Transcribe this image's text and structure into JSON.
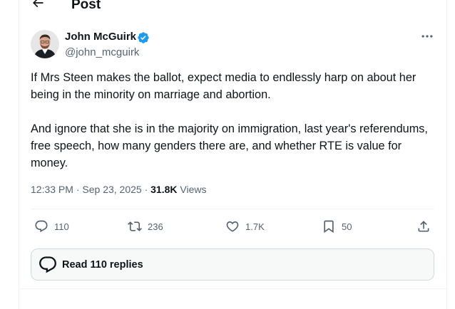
{
  "header": {
    "title": "Post",
    "back_icon": "arrow-left-icon"
  },
  "author": {
    "name": "John McGuirk",
    "handle": "@john_mcguirk",
    "verified_color": "#1d9bf0"
  },
  "tweet": {
    "paragraphs": [
      "If Mrs Steen makes the ballot, expect media to endlessly harp on about her being in the minority on marriage and abortion.",
      "And ignore that she is in the majority on immigration, last year's referendums, free speech, how many genders there are, and whether RTE is value for money."
    ],
    "time": "12:33 PM",
    "separator": "·",
    "date": "Sep 23, 2025",
    "views_count": "31.8K",
    "views_label": "Views"
  },
  "actions": {
    "replies": "110",
    "reposts": "236",
    "likes": "1.7K",
    "bookmarks": "50"
  },
  "read_replies": {
    "label": "Read 110 replies"
  },
  "colors": {
    "text": "#0f1419",
    "secondary": "#536471",
    "border": "#eff3f4",
    "accent": "#1d9bf0"
  }
}
